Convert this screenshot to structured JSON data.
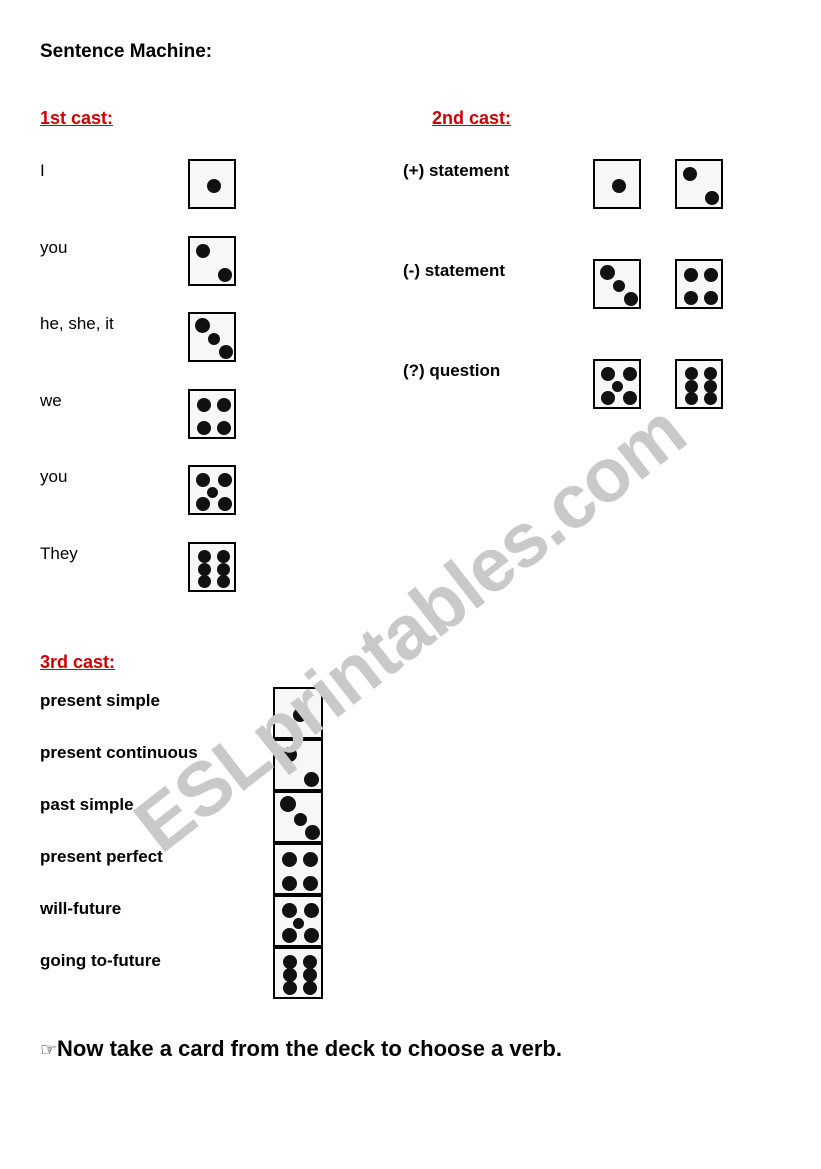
{
  "document": {
    "title": "Sentence Machine:",
    "footer_icon": "pointing-hand-icon",
    "footer_text": "Now take a card from the deck to choose a verb.",
    "watermark": "ESLprintables.com",
    "accent_color": "#cc0000",
    "die_face_color": "#f7f7f7",
    "pip_color": "#111111"
  },
  "first_cast": {
    "heading": "1st cast:",
    "rows": [
      {
        "label": "I",
        "die": 1
      },
      {
        "label": "you",
        "die": 2
      },
      {
        "label": "he, she, it",
        "die": 3
      },
      {
        "label": "we",
        "die": 4
      },
      {
        "label": "you",
        "die": 5
      },
      {
        "label": "They",
        "die": 6
      }
    ]
  },
  "second_cast": {
    "heading": "2nd cast:",
    "rows": [
      {
        "label": "(+) statement",
        "dice": [
          1,
          2
        ]
      },
      {
        "label": "(-) statement",
        "dice": [
          3,
          4
        ]
      },
      {
        "label": "(?) question",
        "dice": [
          5,
          6
        ]
      }
    ]
  },
  "third_cast": {
    "heading": "3rd cast:",
    "rows": [
      {
        "label": "present simple",
        "die": 1
      },
      {
        "label": "present continuous",
        "die": 2
      },
      {
        "label": "past simple",
        "die": 3
      },
      {
        "label": "present perfect",
        "die": 4
      },
      {
        "label": "will-future",
        "die": 5
      },
      {
        "label": "going to-future",
        "die": 6
      }
    ]
  }
}
